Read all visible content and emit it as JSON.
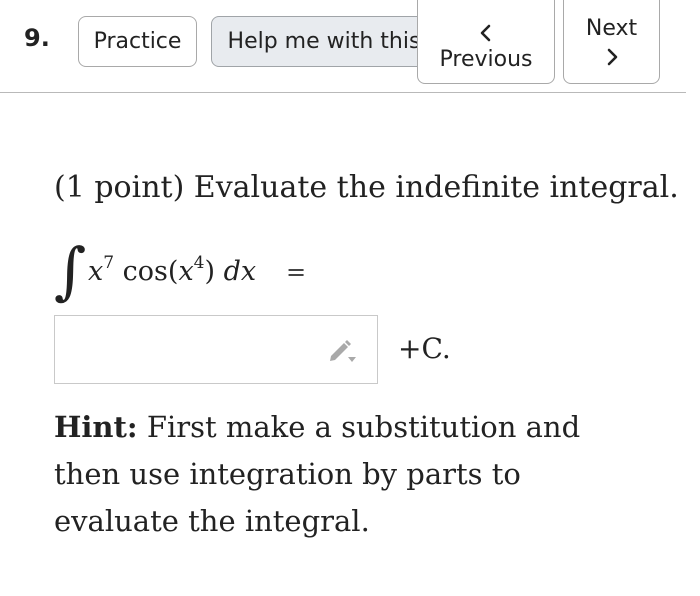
{
  "toolbar": {
    "problem_number": "9.",
    "practice_label": "Practice",
    "help_label": "Help me with this",
    "previous_label": "Previous",
    "next_label": "Next"
  },
  "problem": {
    "prompt": "(1 point) Evaluate the indefinite integral.",
    "integral": {
      "sign": "∫",
      "var_x": "x",
      "power_outer": "7",
      "func": "cos",
      "open_paren": "(",
      "var_x_inner": "x",
      "power_inner": "4",
      "close_paren": ")",
      "differential": "dx",
      "equals": "="
    },
    "answer_value": "",
    "constant": "+C."
  },
  "hint": {
    "label": "Hint:",
    "text": " First make a substitution and then use integration by parts to evaluate the integral."
  },
  "icons": {
    "previous": "chevron-left-icon",
    "next": "chevron-right-icon",
    "answer_tool": "pencil-icon"
  },
  "colors": {
    "help_button_bg": "#e8ebef",
    "border": "#a9a9a9",
    "pencil": "#a9a9a9"
  }
}
